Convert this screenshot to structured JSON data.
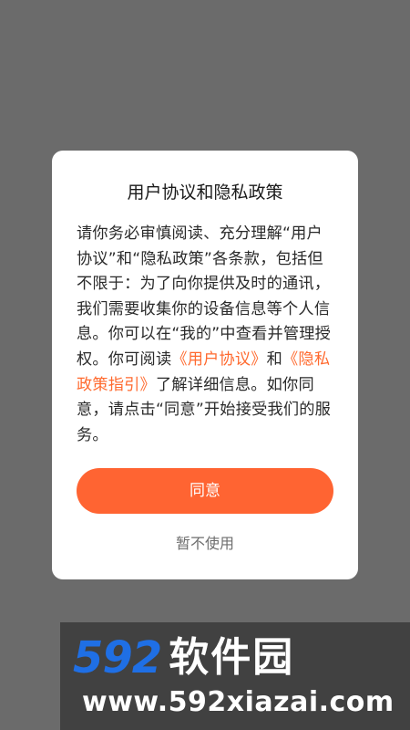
{
  "dialog": {
    "title": "用户协议和隐私政策",
    "body_segments": [
      {
        "text": "请你务必审慎阅读、充分理解“用户协议”和“隐私政策”各条款，包括但不限于：为了向你提供及时的通讯，我们需要收集你的设备信息等个人信息。你可以在“我的”中查看并管理授权。你可阅读",
        "link": false
      },
      {
        "text": "《用户协议》",
        "link": true
      },
      {
        "text": "和",
        "link": false
      },
      {
        "text": "《隐私政策指引》",
        "link": true
      },
      {
        "text": "了解详细信息。如你同意，请点击“同意”开始接受我们的服务。",
        "link": false
      }
    ],
    "agree_label": "同意",
    "decline_label": "暂不使用"
  },
  "watermark": {
    "logo_number": "592",
    "logo_text": "软件园",
    "url": "www.592xiazai.com"
  },
  "colors": {
    "accent": "#ff6432",
    "link": "#ff6a2f",
    "overlay": "#6b6b6b",
    "watermark_blue": "#1f6fe5"
  }
}
